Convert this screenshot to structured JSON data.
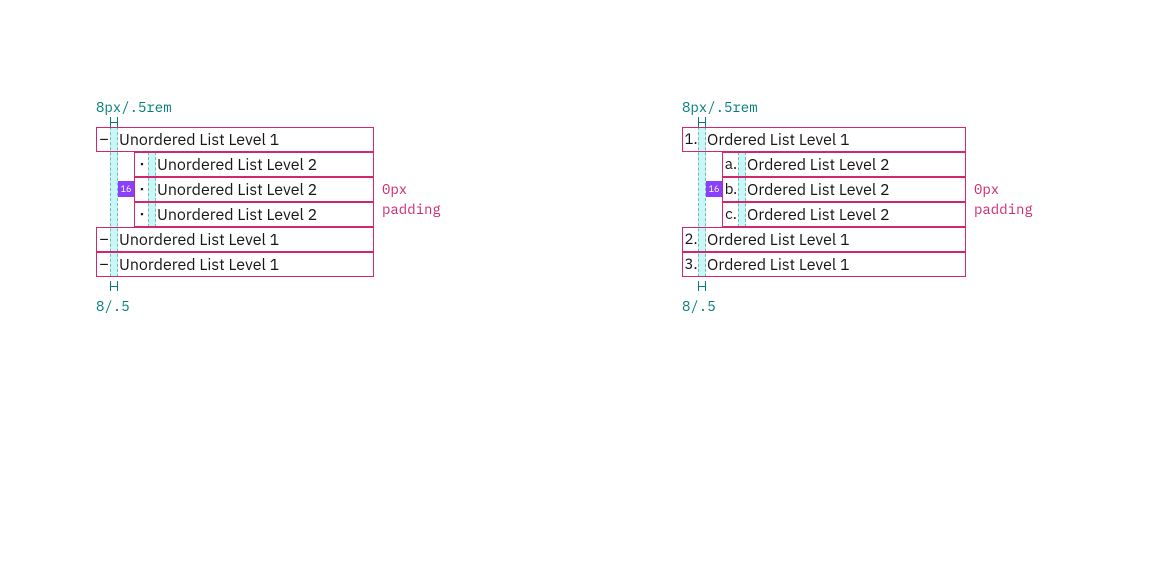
{
  "labels": {
    "top_measure": "8px/.5rem",
    "bottom_measure": "8/.5",
    "indent_chip": "16",
    "padding_note_line1": "0px",
    "padding_note_line2": "padding"
  },
  "unordered": {
    "l1_label": "Unordered List Level 1",
    "l2_label": "Unordered List Level 2",
    "items": [
      {
        "level": 1,
        "text": "Unordered List Level 1"
      },
      {
        "level": 2,
        "text": "Unordered List Level 2"
      },
      {
        "level": 2,
        "text": "Unordered List Level 2"
      },
      {
        "level": 2,
        "text": "Unordered List Level 2"
      },
      {
        "level": 1,
        "text": "Unordered List Level 1"
      },
      {
        "level": 1,
        "text": "Unordered List Level 1"
      }
    ]
  },
  "ordered": {
    "l1_label": "Ordered List Level 1",
    "l2_label": "Ordered List Level 2",
    "items": [
      {
        "level": 1,
        "marker": "1.",
        "text": "Ordered List Level 1"
      },
      {
        "level": 2,
        "marker": "a.",
        "text": "Ordered List Level 2"
      },
      {
        "level": 2,
        "marker": "b.",
        "text": "Ordered List Level 2"
      },
      {
        "level": 2,
        "marker": "c.",
        "text": "Ordered List Level 2"
      },
      {
        "level": 1,
        "marker": "2.",
        "text": "Ordered List Level 1"
      },
      {
        "level": 1,
        "marker": "3.",
        "text": "Ordered List Level 1"
      }
    ]
  }
}
